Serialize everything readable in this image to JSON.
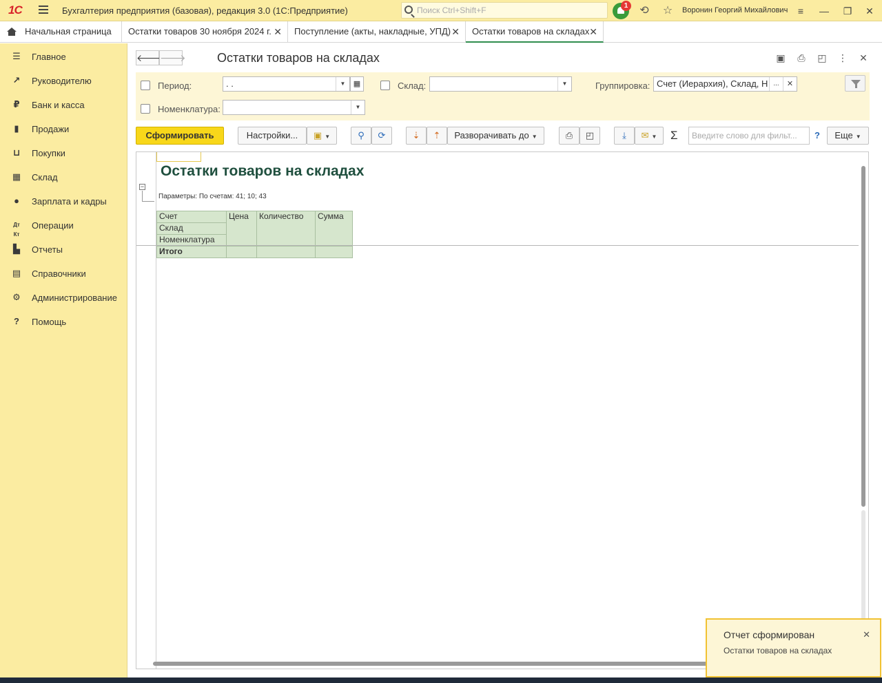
{
  "app": {
    "logo": "1С",
    "title": "Бухгалтерия предприятия (базовая), редакция 3.0  (1С:Предприятие)",
    "search_placeholder": "Поиск Ctrl+Shift+F",
    "notifications_count": "1",
    "user": "Воронин Георгий Михайлович"
  },
  "tabs": [
    {
      "label": "Начальная страница"
    },
    {
      "label": "Остатки товаров 30 ноября 2024 г."
    },
    {
      "label": "Поступление (акты, накладные, УПД)"
    },
    {
      "label": "Остатки товаров на складах"
    }
  ],
  "sidebar": {
    "items": [
      {
        "label": "Главное",
        "icon": "menu-icon"
      },
      {
        "label": "Руководителю",
        "icon": "trend-icon"
      },
      {
        "label": "Банк и касса",
        "icon": "ruble-icon"
      },
      {
        "label": "Продажи",
        "icon": "bag-icon"
      },
      {
        "label": "Покупки",
        "icon": "cart-icon"
      },
      {
        "label": "Склад",
        "icon": "warehouse-icon"
      },
      {
        "label": "Зарплата и кадры",
        "icon": "person-icon"
      },
      {
        "label": "Операции",
        "icon": "dt-kt-icon"
      },
      {
        "label": "Отчеты",
        "icon": "bar-chart-icon"
      },
      {
        "label": "Справочники",
        "icon": "book-icon"
      },
      {
        "label": "Администрирование",
        "icon": "gear-icon"
      },
      {
        "label": "Помощь",
        "icon": "question-icon"
      }
    ]
  },
  "form": {
    "title": "Остатки товаров на складах",
    "filters": {
      "period_label": "Период:",
      "period_value": " .  .",
      "warehouse_label": "Склад:",
      "warehouse_value": "",
      "grouping_label": "Группировка:",
      "grouping_value": "Счет (Иерархия), Склад, Н",
      "grouping_more": "...",
      "nomenclature_label": "Номенклатура:",
      "nomenclature_value": ""
    },
    "toolbar": {
      "generate": "Сформировать",
      "settings": "Настройки...",
      "expand_to": "Разворачивать до",
      "filter_placeholder": "Введите слово для фильт...",
      "help": "?",
      "more": "Еще"
    }
  },
  "report": {
    "title": "Остатки товаров на складах",
    "params": "Параметры: По счетам: 41; 10; 43",
    "headers": {
      "account": "Счет",
      "warehouse": "Склад",
      "nomenclature": "Номенклатура",
      "price": "Цена",
      "quantity": "Количество",
      "sum": "Сумма"
    },
    "total_label": "Итого"
  },
  "notification": {
    "title": "Отчет сформирован",
    "text": "Остатки товаров на складах"
  },
  "colors": {
    "accent_yellow": "#fbeca1",
    "primary_button": "#f8d71a",
    "report_title": "#1f4f3e",
    "table_header": "#d6e6cd"
  }
}
